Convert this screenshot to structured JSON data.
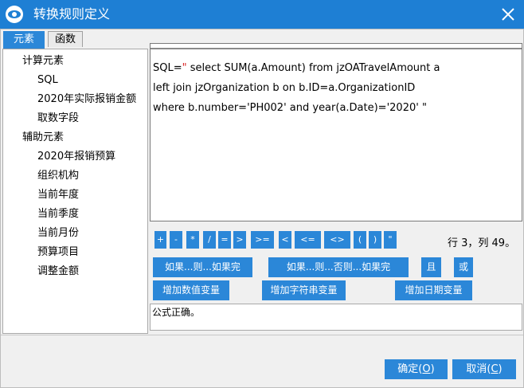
{
  "window": {
    "title": "转换规则定义"
  },
  "tabs": [
    {
      "label": "元素",
      "active": true
    },
    {
      "label": "函数",
      "active": false
    }
  ],
  "tree": {
    "groups": [
      {
        "label": "计算元素",
        "items": [
          "SQL",
          "2020年实际报销金额",
          "取数字段"
        ]
      },
      {
        "label": "辅助元素",
        "items": [
          "2020年报销预算",
          "组织机构",
          "当前年度",
          "当前季度",
          "当前月份",
          "预算项目",
          "调整金额"
        ]
      }
    ]
  },
  "editor": {
    "lines": [
      {
        "pre": "SQL=",
        "quote": "\"",
        "post": " select SUM(a.Amount) from jzOATravelAmount a"
      },
      {
        "pre": "left join jzOrganization b on b.ID=a.OrganizationID",
        "quote": "",
        "post": ""
      },
      {
        "pre": "where b.number='PH002' and year(a.Date)='2020' \"",
        "quote": "",
        "post": ""
      }
    ]
  },
  "operators": [
    "+",
    "-",
    "*",
    "/",
    "=",
    ">",
    ">=",
    "<",
    "<=",
    "<>",
    "(",
    ")",
    "\""
  ],
  "cursor_position": "行 3，列 49。",
  "condition_buttons": [
    "如果...则...如果完",
    "如果...则...否则...如果完",
    "且",
    "或"
  ],
  "variable_buttons": [
    "增加数值变量",
    "增加字符串变量",
    "增加日期变量"
  ],
  "result_text": "公式正确。",
  "footer": {
    "ok_label": "确定(",
    "ok_key": "O",
    "ok_end": ")",
    "cancel_label": "取消(",
    "cancel_key": "C",
    "cancel_end": ")"
  },
  "colors": {
    "titlebar": "#1e7fd4",
    "accent": "#2b87d8",
    "background": "#f0f0f0"
  }
}
